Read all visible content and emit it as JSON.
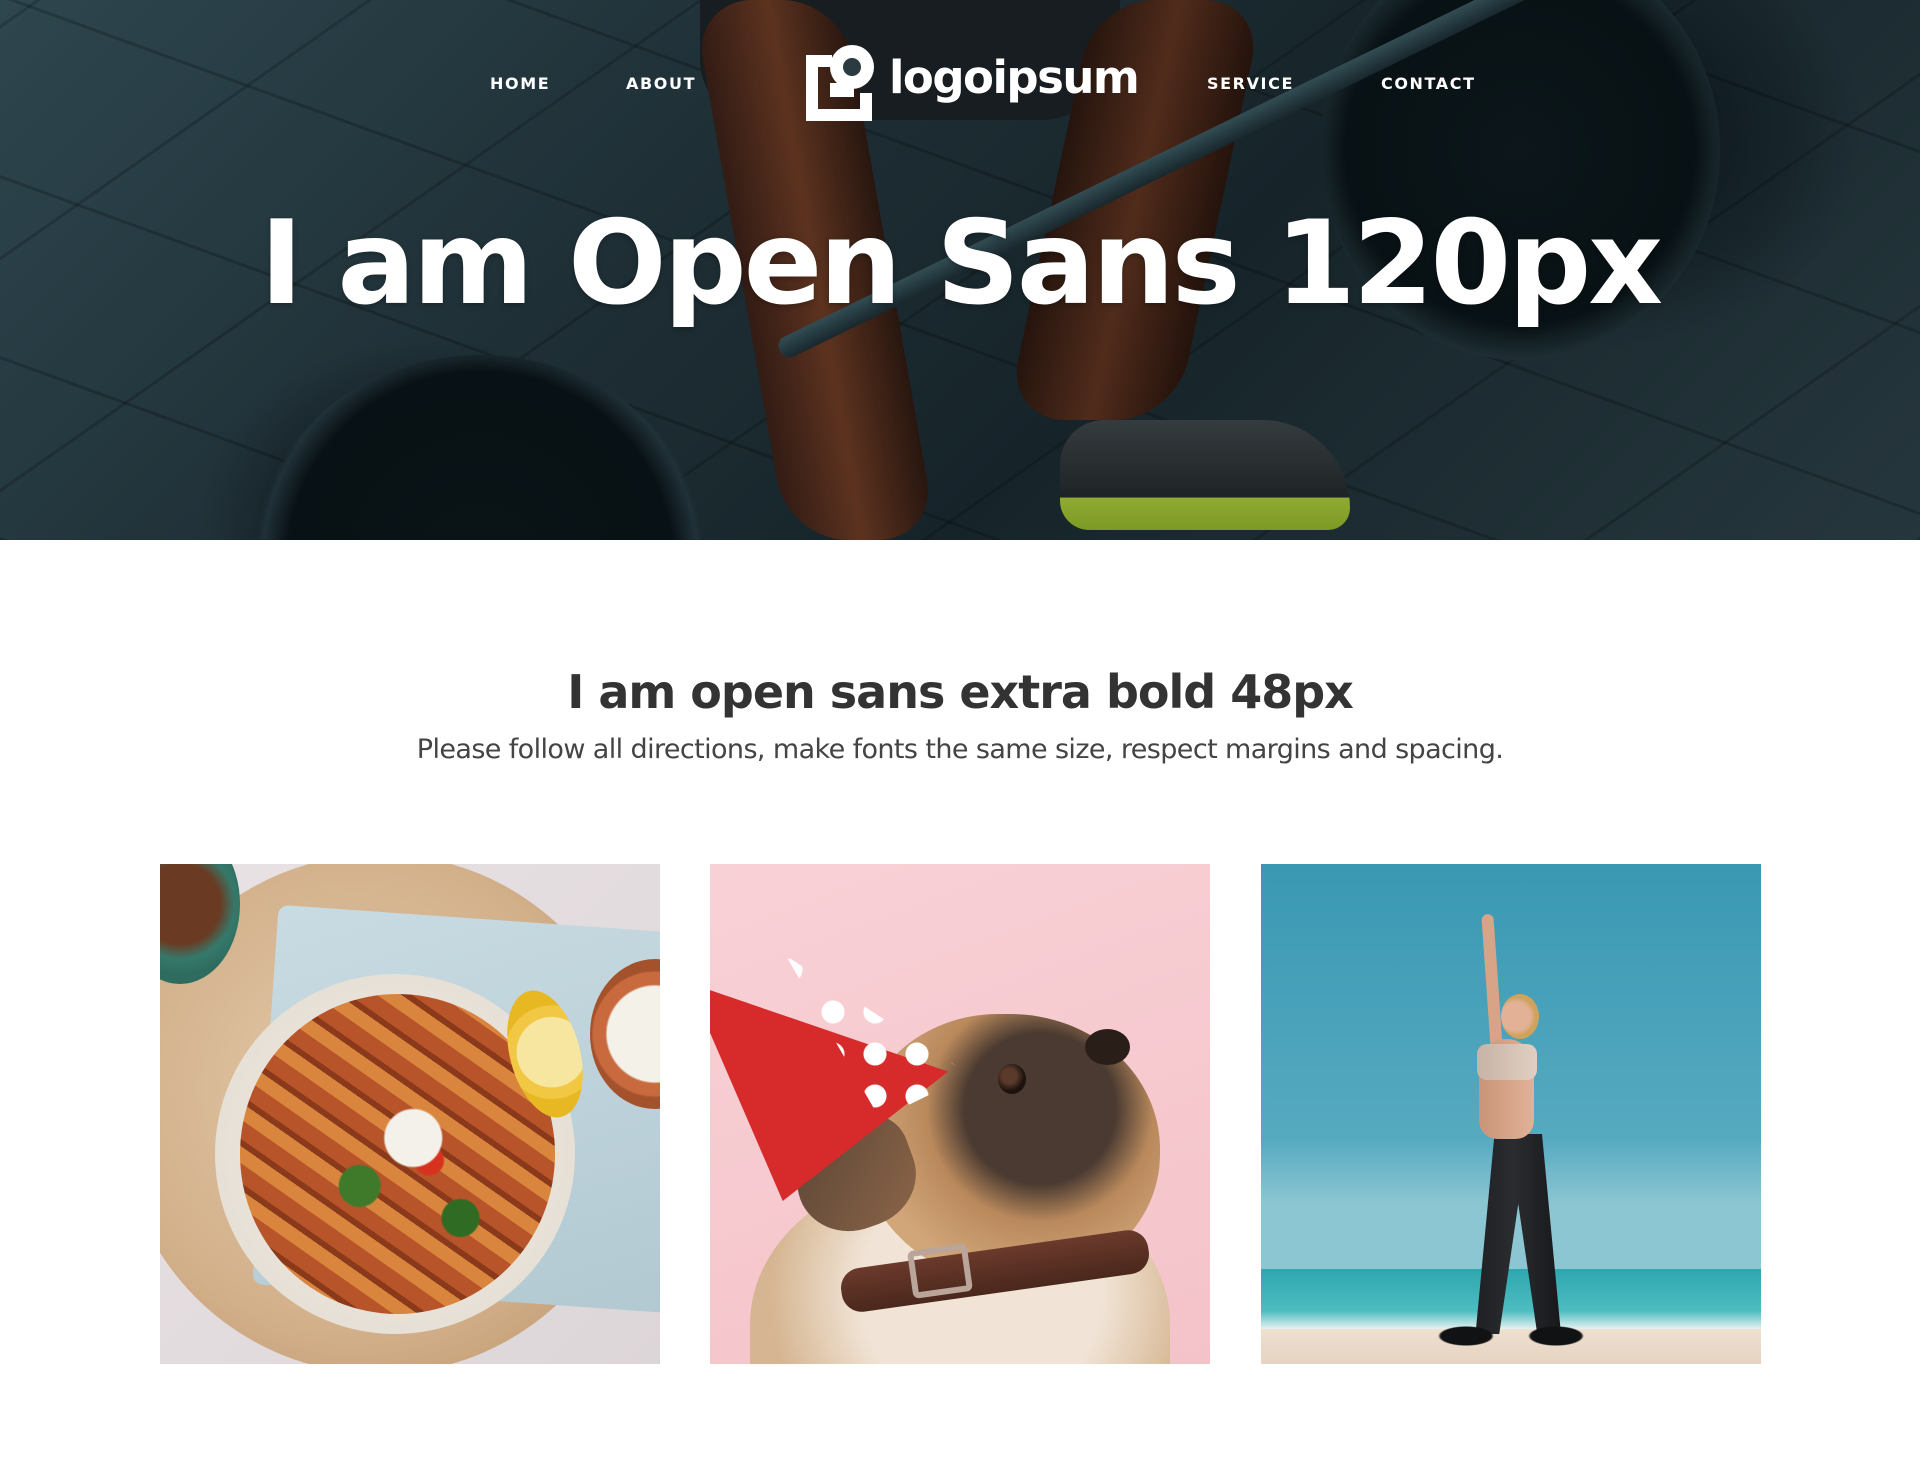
{
  "nav": {
    "home": "HOME",
    "about": "ABOUT",
    "service": "SERVICE",
    "contact": "CONTACT"
  },
  "logo": {
    "text": "logoipsum",
    "icon": "logo-mark-icon"
  },
  "hero": {
    "title": "I am Open Sans 120px",
    "image": "weightlifter-deadlift-photo"
  },
  "intro": {
    "heading": "I am open sans extra bold 48px",
    "subtitle": "Please follow all directions, make fonts the same size, respect margins and spacing."
  },
  "gallery": {
    "items": [
      {
        "image": "food-bowl-fries-photo"
      },
      {
        "image": "dog-party-hat-photo"
      },
      {
        "image": "woman-beach-stretch-photo"
      }
    ]
  },
  "colors": {
    "text_dark": "#333333",
    "text_body": "#444444",
    "nav_text": "#ffffff",
    "background": "#ffffff"
  }
}
